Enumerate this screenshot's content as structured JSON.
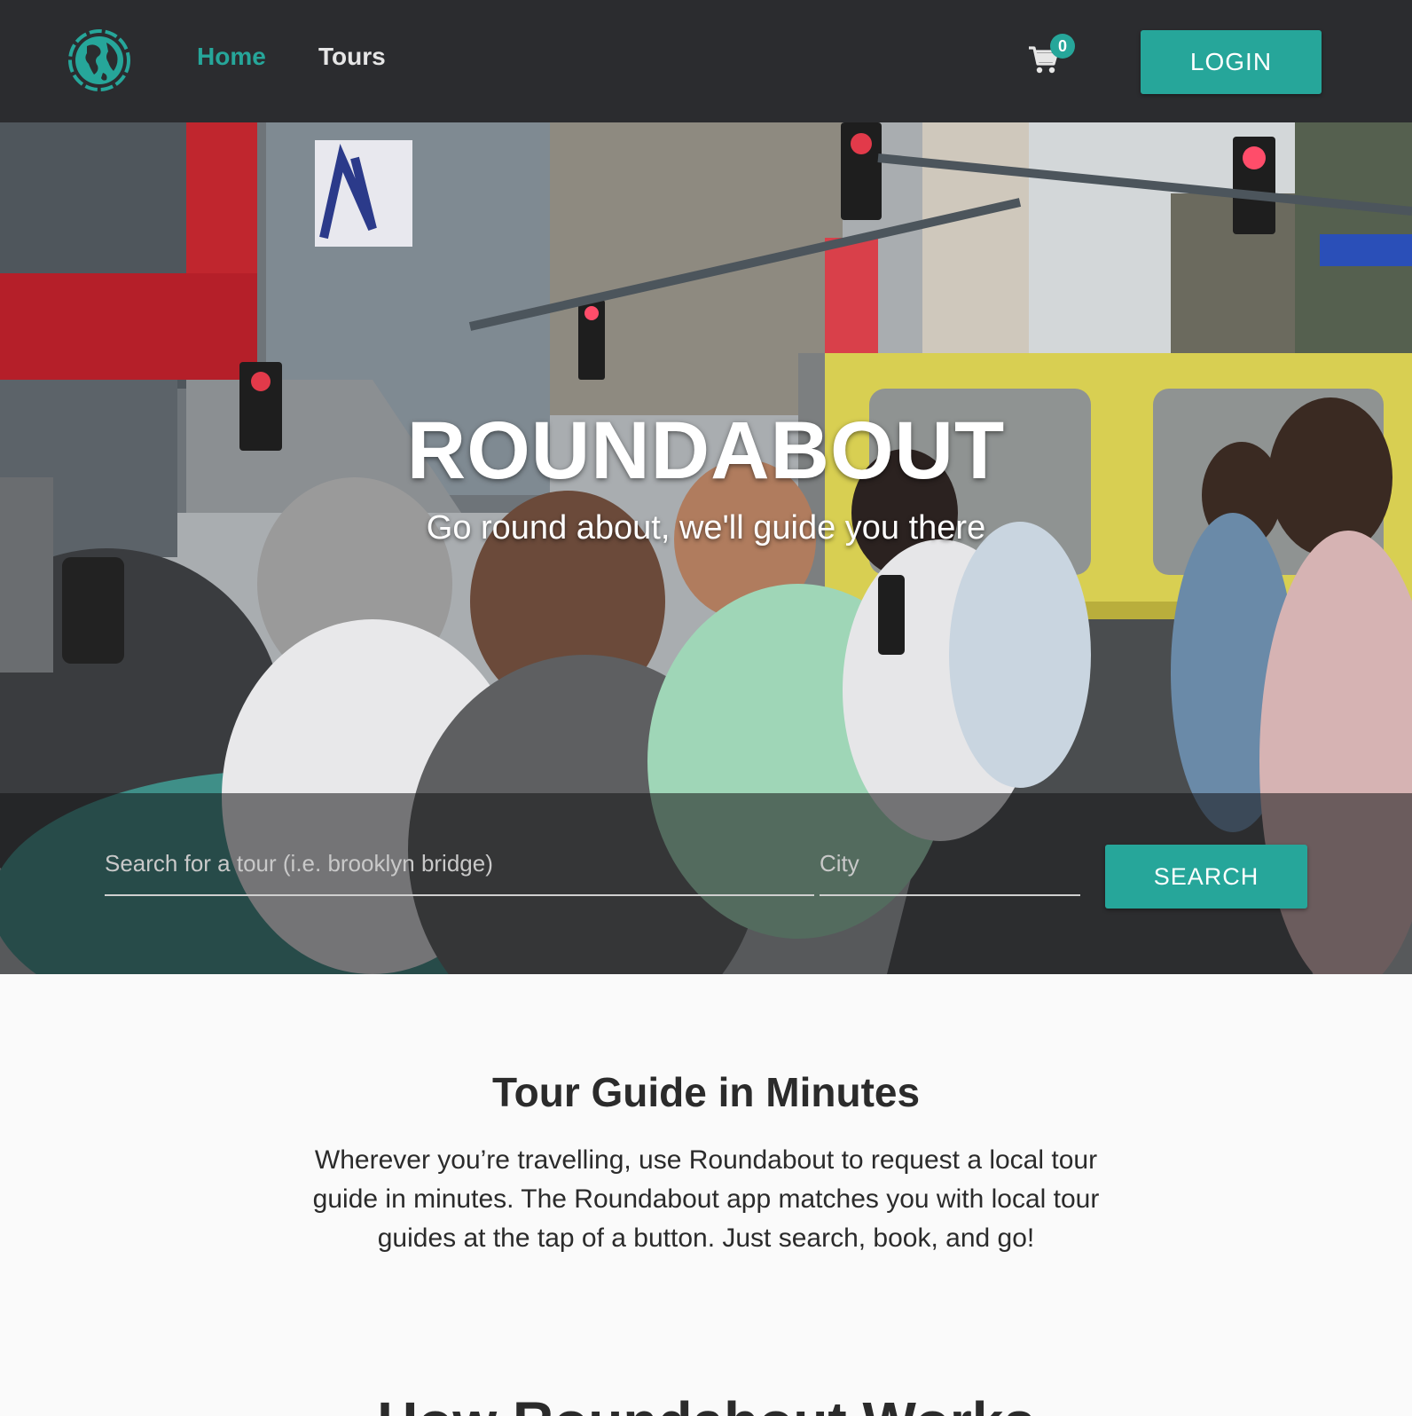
{
  "colors": {
    "accent": "#26a69a",
    "navbar": "#2b2c2f",
    "text": "#2b2b2b"
  },
  "nav": {
    "logo_icon": "globe-icon",
    "links": [
      {
        "label": "Home",
        "active": true
      },
      {
        "label": "Tours",
        "active": false
      }
    ],
    "cart_icon": "cart-icon",
    "cart_count": "0",
    "login_label": "LOGIN"
  },
  "hero": {
    "title": "ROUNDABOUT",
    "subtitle": "Go round about, we'll guide you there",
    "search_placeholder": "Search for a tour (i.e. brooklyn bridge)",
    "city_placeholder": "City",
    "search_button": "SEARCH"
  },
  "intro": {
    "title": "Tour Guide in Minutes",
    "body": "Wherever you’re travelling, use Roundabout to request a local tour guide in minutes. The Roundabout app matches you with local tour guides at the tap of a button. Just search, book, and go!"
  },
  "how": {
    "title": "How Roundabout Works"
  }
}
